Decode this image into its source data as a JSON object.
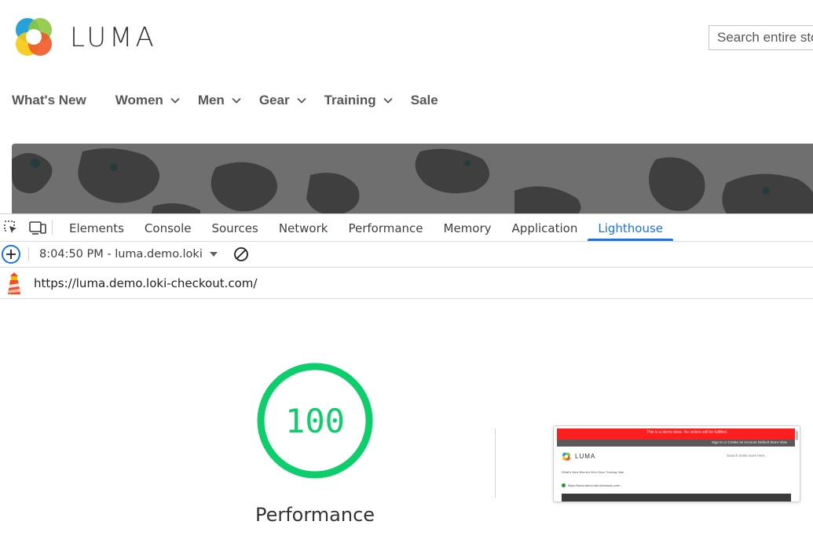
{
  "site": {
    "logo_text": "LUMA",
    "search_placeholder": "Search entire store here...",
    "nav": [
      {
        "label": "What's New",
        "has_dropdown": false
      },
      {
        "label": "Women",
        "has_dropdown": true
      },
      {
        "label": "Men",
        "has_dropdown": true
      },
      {
        "label": "Gear",
        "has_dropdown": true
      },
      {
        "label": "Training",
        "has_dropdown": true
      },
      {
        "label": "Sale",
        "has_dropdown": false
      }
    ]
  },
  "devtools": {
    "icons": [
      "inspect-element-icon",
      "device-toggle-icon"
    ],
    "tabs": [
      "Elements",
      "Console",
      "Sources",
      "Network",
      "Performance",
      "Memory",
      "Application",
      "Lighthouse"
    ],
    "active_tab": "Lighthouse",
    "report_select": "8:04:50 PM - luma.demo.loki",
    "url": "https://luma.demo.loki-checkout.com/",
    "score": "100",
    "category": "Performance",
    "score_color": "#0cce6b",
    "accent_color": "#1a73e8",
    "description_prefix": "",
    "description_link": ""
  },
  "thumbnail": {
    "banner": "This is a demo store. No orders will be fulfilled.",
    "header_links": "Sign In  or  Create an Account   Default Store View",
    "logo_text": "LUMA",
    "search": "Search entire store here...",
    "nav": "What's New    Women    Men    Gear    Training    Sale",
    "message": "https://luma.demo.loki-checkout.com/..."
  }
}
